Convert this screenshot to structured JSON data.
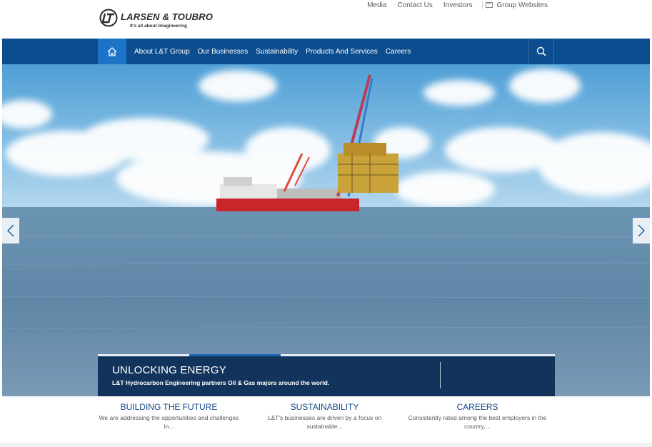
{
  "brand": {
    "name": "LARSEN & TOUBRO",
    "tagline": "It's all about Imagineering"
  },
  "utility": {
    "media": "Media",
    "contact": "Contact Us",
    "investors": "Investors",
    "group_websites": "Group Websites"
  },
  "nav": {
    "home_icon": "home-icon",
    "items": [
      {
        "label": "About L&T Group"
      },
      {
        "label": "Our Businesses"
      },
      {
        "label": "Sustainability"
      },
      {
        "label": "Products And Services"
      },
      {
        "label": "Careers"
      }
    ],
    "search_icon": "search-icon"
  },
  "hero": {
    "title": "UNLOCKING ENERGY",
    "subtitle": "L&T Hydrocarbon Engineering partners Oil & Gas majors around the world.",
    "slide_progress": 0.2,
    "prev_icon": "chevron-left-icon",
    "next_icon": "chevron-right-icon"
  },
  "teasers": [
    {
      "title": "BUILDING THE FUTURE",
      "desc": "We are addressing the opportunities and challenges in..."
    },
    {
      "title": "SUSTAINABILITY",
      "desc": "L&T's businesses are driven by a focus on sustainable..."
    },
    {
      "title": "CAREERS",
      "desc": "Consistently rated among the best employers in the country,..."
    }
  ],
  "colors": {
    "nav_bg": "#0b4d8e",
    "home_active": "#1d73c8",
    "caption_bg": "#12335c",
    "teaser_title": "#134a8a"
  }
}
